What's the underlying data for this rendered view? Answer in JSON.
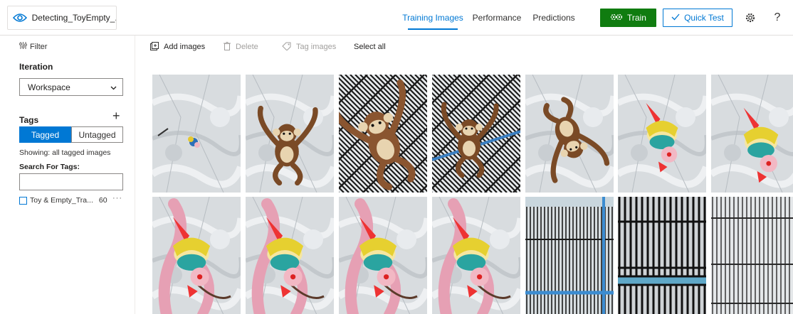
{
  "header": {
    "project_name": "Detecting_ToyEmpty_...",
    "tabs": [
      {
        "label": "Training Images",
        "active": true
      },
      {
        "label": "Performance",
        "active": false
      },
      {
        "label": "Predictions",
        "active": false
      }
    ],
    "train_label": "Train",
    "quick_test_label": "Quick Test",
    "settings_icon": "gear-icon",
    "help_label": "?"
  },
  "sidebar": {
    "filter_label": "Filter",
    "iteration_title": "Iteration",
    "iteration_value": "Workspace",
    "tags_title": "Tags",
    "tagged_label": "Tagged",
    "untagged_label": "Untagged",
    "showing_text": "Showing: all tagged images",
    "search_label": "Search For Tags:",
    "search_value": "",
    "tags": [
      {
        "name": "Toy & Empty_Tra...",
        "count": "60"
      }
    ]
  },
  "toolbar": {
    "add_images": "Add images",
    "delete": "Delete",
    "tag_images": "Tag images",
    "select_all": "Select all"
  },
  "colors": {
    "accent": "#0078d4",
    "train_green": "#107c10"
  },
  "images": [
    {
      "kind": "floor-small-toy"
    },
    {
      "kind": "floor-monkey"
    },
    {
      "kind": "cage-monkey-big"
    },
    {
      "kind": "cage-monkey"
    },
    {
      "kind": "floor-monkey-back"
    },
    {
      "kind": "floor-clown"
    },
    {
      "kind": "floor-clown-partial"
    },
    {
      "kind": "floor-clown-pink"
    },
    {
      "kind": "floor-clown-pink"
    },
    {
      "kind": "floor-clown-pink"
    },
    {
      "kind": "floor-clown-pink"
    },
    {
      "kind": "cage-empty-blue"
    },
    {
      "kind": "cage-empty-dark"
    },
    {
      "kind": "cage-empty-light"
    }
  ]
}
